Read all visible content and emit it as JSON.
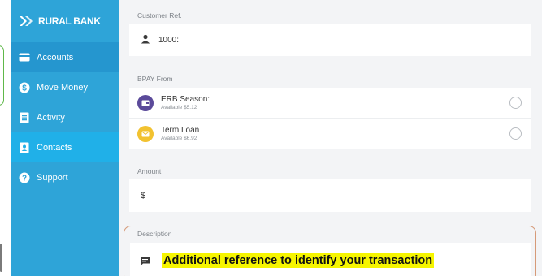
{
  "brand": {
    "name": "RURAL BANK"
  },
  "sidebar": {
    "items": [
      {
        "label": "Accounts",
        "icon": "card-icon"
      },
      {
        "label": "Move Money",
        "icon": "dollar-circle-icon"
      },
      {
        "label": "Activity",
        "icon": "list-icon"
      },
      {
        "label": "Contacts",
        "icon": "contact-card-icon"
      },
      {
        "label": "Support",
        "icon": "question-circle-icon"
      }
    ]
  },
  "form": {
    "customer_ref": {
      "label": "Customer Ref.",
      "value": "1000:",
      "icon": "person-icon"
    },
    "bpay_from": {
      "label": "BPAY From",
      "accounts": [
        {
          "name": "ERB Season:",
          "available": "Available $5.12",
          "icon_color": "#5b4a9a",
          "icon": "wallet-icon"
        },
        {
          "name": "Term Loan",
          "available": "Available $6.92",
          "icon_color": "#f2c230",
          "icon": "envelope-icon"
        }
      ]
    },
    "amount": {
      "label": "Amount",
      "currency_symbol": "$"
    },
    "description": {
      "label": "Description",
      "value": "Additional reference to identify your transaction",
      "icon": "message-icon"
    }
  },
  "colors": {
    "sidebar": "#2ea4d8",
    "sidebar_active": "#2596cf",
    "annotation_highlight": "#f6f500",
    "annotation_border": "#d69a78"
  }
}
